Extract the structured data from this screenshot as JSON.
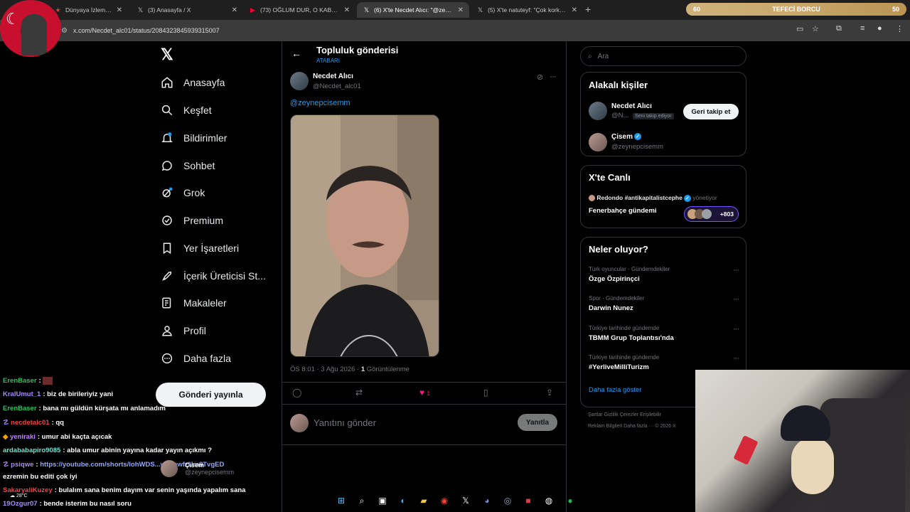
{
  "browser": {
    "tabs": [
      {
        "title": "Dünyaya İzlemeye Gelm",
        "icon": "flag-icon"
      },
      {
        "title": "(3) Anasayfa / X",
        "icon": "x-icon"
      },
      {
        "title": "(73) OĞLUM DUR, O KABLOLU",
        "icon": "youtube-icon"
      },
      {
        "title": "(6) X'te Necdet Alıcı: \"@zeynepc",
        "icon": "x-icon",
        "active": true
      },
      {
        "title": "(5) X'te natuteyf: \"Çok korkunç",
        "icon": "x-icon"
      }
    ],
    "url": "x.com/Necdet_alc01/status/2084323845939315007",
    "debt_bar": {
      "left": "60",
      "label": "TEFECİ BORCU",
      "right": "50"
    }
  },
  "nav": {
    "items": [
      {
        "label": "Anasayfa",
        "icon": "home-icon"
      },
      {
        "label": "Keşfet",
        "icon": "search-icon"
      },
      {
        "label": "Bildirimler",
        "icon": "bell-icon"
      },
      {
        "label": "Sohbet",
        "icon": "chat-icon"
      },
      {
        "label": "Grok",
        "icon": "grok-icon"
      },
      {
        "label": "Premium",
        "icon": "premium-icon"
      },
      {
        "label": "Yer İşaretleri",
        "icon": "bookmark-icon"
      },
      {
        "label": "İçerik Üreticisi St...",
        "icon": "rocket-icon"
      },
      {
        "label": "Makaleler",
        "icon": "article-icon"
      },
      {
        "label": "Profil",
        "icon": "profile-icon"
      },
      {
        "label": "Daha fazla",
        "icon": "more-icon"
      }
    ],
    "post_button": "Gönderi yayınla"
  },
  "post": {
    "header_title": "Topluluk gönderisi",
    "header_sub": "ATABARI",
    "author_name": "Necdet Alıcı",
    "author_handle": "@Necdet_alc01",
    "mention": "@zeynepcisemm",
    "time": "ÖS 8:01 · 3 Ağu 2026 · ",
    "views_count": "1",
    "views_label": " Görüntülenme",
    "like_count": "1",
    "reply_placeholder": "Yanıtını gönder",
    "reply_button": "Yanıtla"
  },
  "sidebar": {
    "search_placeholder": "Ara",
    "relevant_title": "Alakalı kişiler",
    "people": [
      {
        "name": "Necdet Alıcı",
        "handle": "@N...",
        "badge": "Seni takip ediyor",
        "button": "Geri takip et"
      },
      {
        "name": "Çisem",
        "handle": "@zeynepcisemm"
      }
    ],
    "live_title": "X'te Canlı",
    "live_host": "Redondo #antikapitalistcephe",
    "live_role": "yönetiyor",
    "live_topic": "Fenerbahçe gündemi",
    "live_count": "+803",
    "trends_title": "Neler oluyor?",
    "trends": [
      {
        "meta": "Türk oyuncular · Gündemdekiler",
        "name": "Özge Özpirinçci"
      },
      {
        "meta": "Spor · Gündemdekiler",
        "name": "Darwin Nunez"
      },
      {
        "meta": "Türkiye tarihinde gündemde",
        "name": "TBMM Grup Toplantısı'nda"
      },
      {
        "meta": "Türkiye tarihinde gündemde",
        "name": "#YerliveMilliTurizm"
      }
    ],
    "show_more": "Daha fazla göster",
    "footer1": "Şartlar   Gizlilik   Çerezler   Erişilebilir",
    "footer2": "Reklam Bilgileri   Daha fazla ···   © 2026 X"
  },
  "chat": [
    {
      "user": "ErenBaser",
      "msg": ":",
      "color": "#22c55e"
    },
    {
      "user": "KralUmut_1",
      "msg": ": biz de birileriyiz yani",
      "color": "#a78bfa"
    },
    {
      "user": "ErenBaser",
      "msg": ": bana mı güldün kürşata mı anlamadım",
      "color": "#22c55e"
    },
    {
      "user": "necdetalc01",
      "msg": ": qq",
      "color": "#ef4444"
    },
    {
      "user": "yeniraki",
      "msg": ": umur abi kaçta açıcak",
      "color": "#c084fc"
    },
    {
      "user": "ardababapiro9085",
      "msg": ": abla umur abinin yayına kadar yayın açıkmı ?",
      "color": "#5eead4"
    },
    {
      "user": "psiqwe",
      "msg": ":",
      "color": "#a78bfa"
    },
    {
      "user": "",
      "msg": "ezremin bu editi çok iyi",
      "color": "#ffffff"
    },
    {
      "user": "SakaryaliKuzey",
      "msg": ": bulalım sana benim dayım var senin yaşında yapalım sana",
      "color": "#ef4444"
    },
    {
      "user": "19Ozgur07",
      "msg": ": bende isterim bu nasıl soru",
      "color": "#a78bfa"
    }
  ],
  "chat_link": "https://youtube.com/shorts/lohWDS...wMfewfzUm8TvgED",
  "overlay": {
    "name": "Çisem",
    "handle": "@zeynepcisemm"
  },
  "weather": {
    "temp": "28°C"
  }
}
